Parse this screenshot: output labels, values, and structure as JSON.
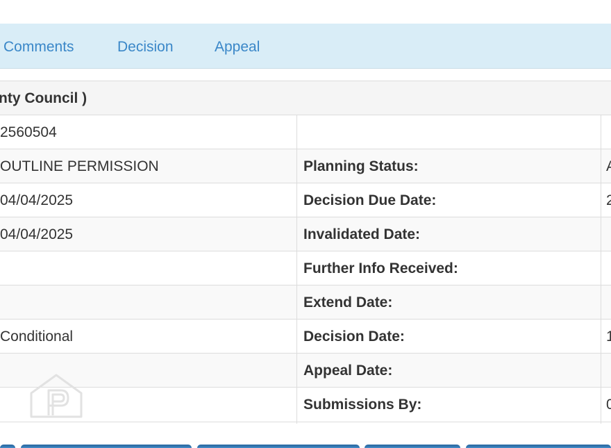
{
  "tabs": [
    {
      "label": "Comments"
    },
    {
      "label": "Decision"
    },
    {
      "label": "Appeal"
    }
  ],
  "section": {
    "title": "nty Council )"
  },
  "rows": [
    {
      "value": "2560504",
      "label": "",
      "value2": ""
    },
    {
      "value": "OUTLINE PERMISSION",
      "label": "Planning Status:",
      "value2": "A"
    },
    {
      "value": "04/04/2025",
      "label": "Decision Due Date:",
      "value2": "2"
    },
    {
      "value": "04/04/2025",
      "label": "Invalidated Date:",
      "value2": ""
    },
    {
      "value": "",
      "label": "Further Info Received:",
      "value2": ""
    },
    {
      "value": "",
      "label": "Extend Date:",
      "value2": ""
    },
    {
      "value": "Conditional",
      "label": "Decision Date:",
      "value2": "1"
    },
    {
      "value": "",
      "label": "Appeal Date:",
      "value2": ""
    },
    {
      "value": "",
      "label": "Submissions By:",
      "value2": "0"
    }
  ],
  "watermark": {
    "icon": "property-house-icon"
  }
}
